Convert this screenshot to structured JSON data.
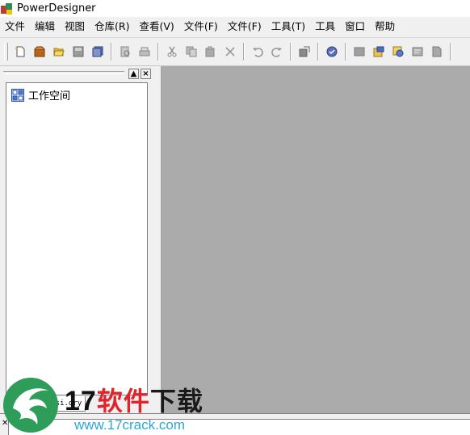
{
  "window": {
    "title": "PowerDesigner"
  },
  "menu": {
    "items": [
      "文件",
      "编辑",
      "视图",
      "仓库(R)",
      "查看(V)",
      "文件(F)",
      "文件(F)",
      "工具(T)",
      "工具",
      "窗口",
      "帮助"
    ]
  },
  "toolbar": {
    "icons": [
      "new-icon",
      "package-icon",
      "open-folder-icon",
      "save-icon",
      "save-all-icon",
      "print-preview-icon",
      "print-icon",
      "cut-icon",
      "copy-icon",
      "paste-icon",
      "delete-icon",
      "undo-icon",
      "redo-icon",
      "properties-icon",
      "check-model-icon",
      "generate-icon",
      "reverse-engineer-icon",
      "impact-analysis-icon",
      "report-icon",
      "merge-icon"
    ]
  },
  "workspace": {
    "root_label": "工作空间",
    "tab_label": "Reposi.ory"
  },
  "watermark": {
    "number": "17",
    "text_red": "软件",
    "text_dark": "下载",
    "url": "www.17crack.com"
  },
  "colors": {
    "main_area": "#ababab",
    "watermark_red": "#e0242b",
    "watermark_blue": "#2aa6d9",
    "watermark_green": "#2e9d5a"
  }
}
